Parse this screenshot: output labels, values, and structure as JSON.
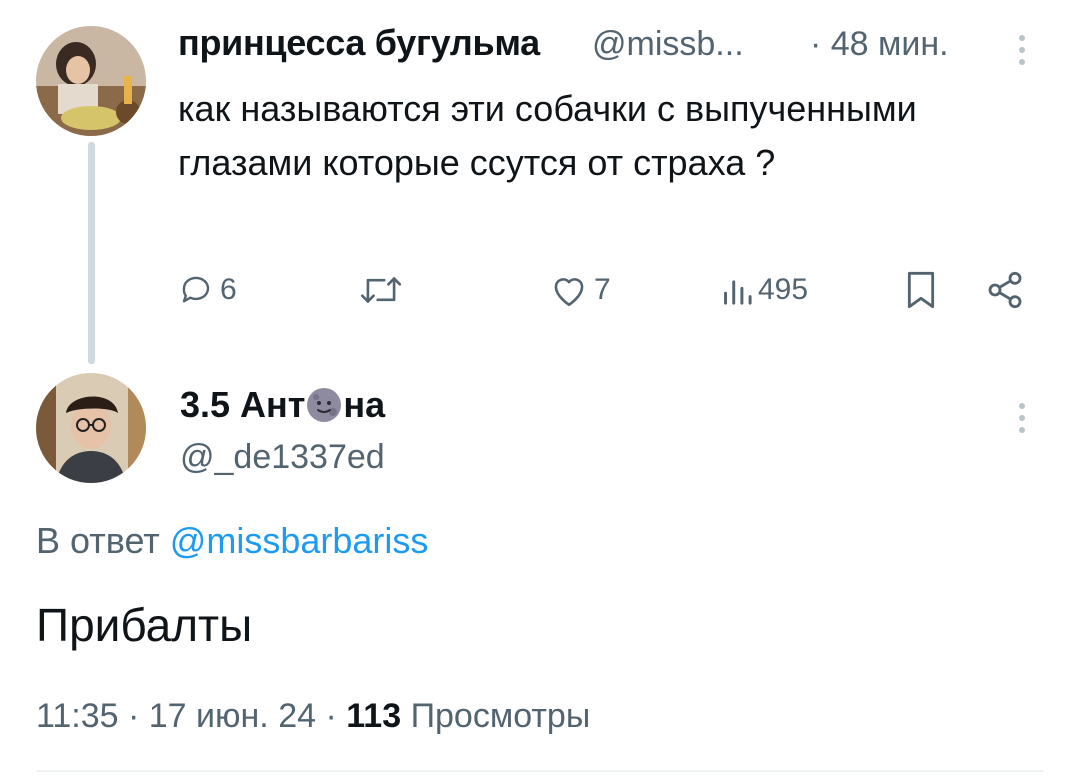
{
  "parent_tweet": {
    "author_name": "принцесса бугульма",
    "handle": "@missb...",
    "time": "· 48 мин.",
    "text": "как называются эти собачки с выпученными глазами которые ссутся от страха ?",
    "actions": {
      "reply_count": "6",
      "like_count": "7",
      "views_count": "495"
    }
  },
  "reply_tweet": {
    "author_name_before": "3.5 Ант",
    "author_name_emoji": "moon-face-icon",
    "author_name_after": "на",
    "handle": "@_de1337ed",
    "reply_to_prefix": "В ответ",
    "reply_to_mention": "@missbarbariss",
    "text": "Прибалты",
    "time": "11:35 · 17 июн. 24 ·",
    "views_count": "113",
    "views_label": "Просмотры"
  },
  "colors": {
    "text": "#0f1419",
    "secondary": "#536471",
    "link": "#1d9bf0",
    "thread_line": "#cfd9de"
  }
}
